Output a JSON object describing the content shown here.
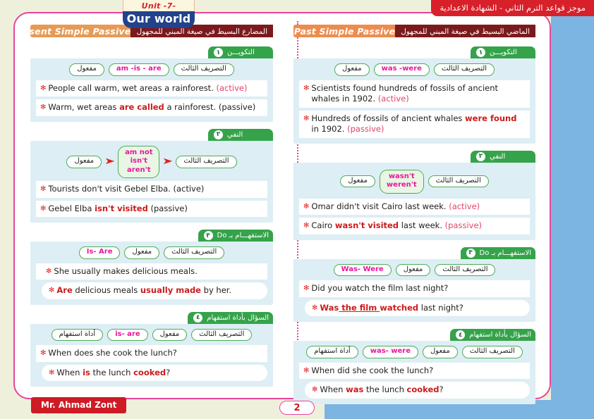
{
  "banner": {
    "unit": "Unit -7-",
    "title": "Our world"
  },
  "top_tag": "موجز قواعد الترم الثاني - الشهادة الاعدادية",
  "footer": {
    "author": "Mr. Ahmad Zont",
    "page_number": "2"
  },
  "columns": [
    {
      "title_en": "The Present Simple Passive",
      "title_ar": "المضارع البسيط في صيغة المبني للمجهول",
      "sections": [
        {
          "number": "١",
          "label": "التكويـــن",
          "pills": [
            {
              "text": "التصريف الثالث",
              "lang": "ar"
            },
            {
              "text": "am -is - are",
              "lang": "en"
            },
            {
              "text": "مفعول",
              "lang": "ar"
            }
          ],
          "sentences": [
            {
              "parts": [
                {
                  "t": "People call warm, wet areas a rainforest. ",
                  "s": "n"
                },
                {
                  "t": "(active)",
                  "s": "tag"
                }
              ],
              "style": "plain"
            },
            {
              "parts": [
                {
                  "t": "Warm, wet areas ",
                  "s": "n"
                },
                {
                  "t": "are called",
                  "s": "b"
                },
                {
                  "t": " a rainforest. ",
                  "s": "n"
                },
                {
                  "t": "(passive)",
                  "s": "n"
                }
              ],
              "style": "plain"
            }
          ]
        },
        {
          "number": "٢",
          "label": "النفي",
          "pills": [
            {
              "text": "التصريف الثالث",
              "lang": "ar"
            },
            {
              "text": "arrow",
              "lang": "arrow"
            },
            {
              "text": "am not\nisn't\naren't",
              "lang": "multi"
            },
            {
              "text": "arrow",
              "lang": "arrow"
            },
            {
              "text": "مفعول",
              "lang": "ar"
            }
          ],
          "sentences": [
            {
              "parts": [
                {
                  "t": "Tourists don't visit Gebel Elba. (active)",
                  "s": "n"
                }
              ],
              "style": "plain"
            },
            {
              "parts": [
                {
                  "t": "Gebel Elba ",
                  "s": "n"
                },
                {
                  "t": "isn't visited",
                  "s": "b"
                },
                {
                  "t": "  (passive)",
                  "s": "n"
                }
              ],
              "style": "plain"
            }
          ]
        },
        {
          "number": "٣",
          "label": "الاستفهـــام بـ Do",
          "pills": [
            {
              "text": "التصريف الثالث",
              "lang": "ar"
            },
            {
              "text": "مفعول",
              "lang": "ar"
            },
            {
              "text": "Is- Are",
              "lang": "en"
            }
          ],
          "sentences": [
            {
              "parts": [
                {
                  "t": "She usually makes delicious meals.",
                  "s": "n"
                }
              ],
              "style": "indent"
            },
            {
              "parts": [
                {
                  "t": "Are",
                  "s": "b"
                },
                {
                  "t": " delicious meals ",
                  "s": "n"
                },
                {
                  "t": "usually made",
                  "s": "b"
                },
                {
                  "t": " by her.",
                  "s": "n"
                }
              ],
              "style": "round"
            }
          ]
        },
        {
          "number": "٤",
          "label": "السؤال بأداة استفهام",
          "pills": [
            {
              "text": "التصريف الثالث",
              "lang": "ar"
            },
            {
              "text": "مفعول",
              "lang": "ar"
            },
            {
              "text": "is- are",
              "lang": "en"
            },
            {
              "text": "أداة استفهام",
              "lang": "ar"
            }
          ],
          "sentences": [
            {
              "parts": [
                {
                  "t": "When does she cook the lunch?",
                  "s": "n"
                }
              ],
              "style": "plain"
            },
            {
              "parts": [
                {
                  "t": "When ",
                  "s": "n"
                },
                {
                  "t": "is",
                  "s": "b"
                },
                {
                  "t": " the lunch ",
                  "s": "n"
                },
                {
                  "t": "cooked",
                  "s": "b"
                },
                {
                  "t": "?",
                  "s": "n"
                }
              ],
              "style": "round"
            }
          ]
        }
      ]
    },
    {
      "title_en": "The Past Simple Passive",
      "title_ar": "الماضي البسيط في صيغة المبني للمجهول",
      "sections": [
        {
          "number": "١",
          "label": "التكويـــن",
          "pills": [
            {
              "text": "التصريف الثالث",
              "lang": "ar"
            },
            {
              "text": "was -were",
              "lang": "en"
            },
            {
              "text": "مفعول",
              "lang": "ar"
            }
          ],
          "sentences": [
            {
              "parts": [
                {
                  "t": "Scientists found hundreds of fossils of ancient whales in 1902. ",
                  "s": "n"
                },
                {
                  "t": "(active)",
                  "s": "tag"
                }
              ],
              "style": "plain"
            },
            {
              "parts": [
                {
                  "t": "Hundreds of fossils of ancient whales ",
                  "s": "n"
                },
                {
                  "t": "were found",
                  "s": "b"
                },
                {
                  "t": " in 1902. ",
                  "s": "n"
                },
                {
                  "t": "(passive)",
                  "s": "tag"
                }
              ],
              "style": "plain"
            }
          ]
        },
        {
          "number": "٢",
          "label": "النفي",
          "pills": [
            {
              "text": "التصريف الثالث",
              "lang": "ar"
            },
            {
              "text": "wasn't\nweren't",
              "lang": "multi"
            },
            {
              "text": "مفعول",
              "lang": "ar"
            }
          ],
          "sentences": [
            {
              "parts": [
                {
                  "t": "Omar didn't visit Cairo last week. ",
                  "s": "n"
                },
                {
                  "t": "(active)",
                  "s": "tag"
                }
              ],
              "style": "plain"
            },
            {
              "parts": [
                {
                  "t": "Cairo ",
                  "s": "n"
                },
                {
                  "t": "wasn't visited",
                  "s": "b"
                },
                {
                  "t": " last week.  ",
                  "s": "n"
                },
                {
                  "t": "(passive)",
                  "s": "tag"
                }
              ],
              "style": "plain"
            }
          ]
        },
        {
          "number": "٣",
          "label": "الاستفهـــام بـ Do",
          "pills": [
            {
              "text": "التصريف الثالث",
              "lang": "ar"
            },
            {
              "text": "مفعول",
              "lang": "ar"
            },
            {
              "text": "Was- Were",
              "lang": "en"
            }
          ],
          "sentences": [
            {
              "parts": [
                {
                  "t": "   Did you watch the film last night?",
                  "s": "n"
                }
              ],
              "style": "plain"
            },
            {
              "parts": [
                {
                  "t": "Was",
                  "s": "b"
                },
                {
                  "t": " the film ",
                  "s": "bu"
                },
                {
                  "t": "watched",
                  "s": "b"
                },
                {
                  "t": " last night?",
                  "s": "n"
                }
              ],
              "style": "round"
            }
          ]
        },
        {
          "number": "٤",
          "label": "السؤال بأداة استفهام",
          "pills": [
            {
              "text": "التصريف الثالث",
              "lang": "ar"
            },
            {
              "text": "مفعول",
              "lang": "ar"
            },
            {
              "text": "was- were",
              "lang": "en"
            },
            {
              "text": "أداة استفهام",
              "lang": "ar"
            }
          ],
          "sentences": [
            {
              "parts": [
                {
                  "t": "When did she cook the lunch?",
                  "s": "n"
                }
              ],
              "style": "plain"
            },
            {
              "parts": [
                {
                  "t": "When ",
                  "s": "n"
                },
                {
                  "t": "was",
                  "s": "b"
                },
                {
                  "t": " the lunch ",
                  "s": "n"
                },
                {
                  "t": "cooked",
                  "s": "b"
                },
                {
                  "t": "?",
                  "s": "n"
                }
              ],
              "style": "round"
            }
          ]
        }
      ]
    }
  ]
}
